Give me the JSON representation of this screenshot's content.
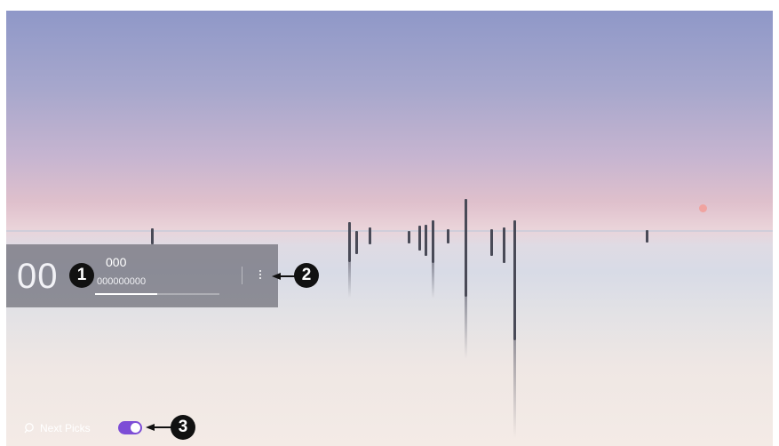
{
  "info_panel": {
    "clock": "00",
    "title": "000",
    "subtitle": "000000000",
    "progress": 0.5
  },
  "menu": {
    "icon": "more-vertical-icon"
  },
  "callouts": {
    "one": "1",
    "two": "2",
    "three": "3"
  },
  "bottom_bar": {
    "search_icon": "search-icon",
    "label": "Next Picks",
    "toggle_on": true
  },
  "colors": {
    "accent": "#7d4dd6"
  }
}
